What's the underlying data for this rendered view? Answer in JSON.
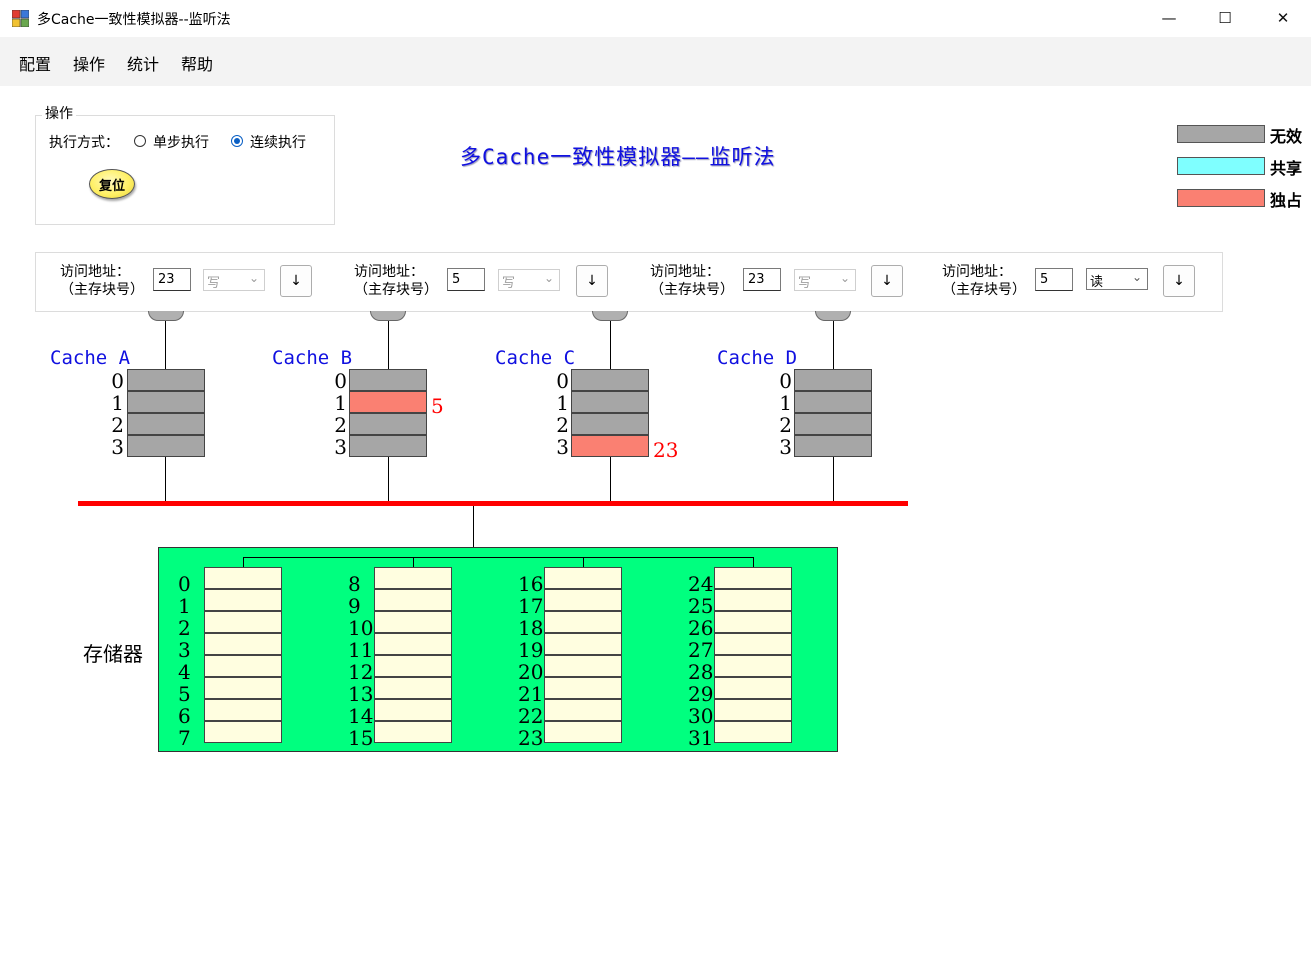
{
  "window": {
    "title": "多Cache一致性模拟器--监听法",
    "minimize": "—",
    "maximize": "☐",
    "close": "✕"
  },
  "menu": [
    "配置",
    "操作",
    "统计",
    "帮助"
  ],
  "operation": {
    "legend": "操作",
    "mode_label": "执行方式：",
    "modes": [
      {
        "label": "单步执行",
        "selected": false
      },
      {
        "label": "连续执行",
        "selected": true
      }
    ],
    "reset_label": "复位"
  },
  "main_title": "多Cache一致性模拟器——监听法",
  "legend": [
    {
      "label": "无效",
      "color": "#a6a6a6"
    },
    {
      "label": "共享",
      "color": "#7fffff"
    },
    {
      "label": "独占",
      "color": "#fa8072"
    }
  ],
  "access_label": [
    "访问地址：",
    "（主存块号）"
  ],
  "processors": [
    {
      "address": "23",
      "op": "写",
      "enabled": false,
      "step": "↓"
    },
    {
      "address": "5",
      "op": "写",
      "enabled": false,
      "step": "↓"
    },
    {
      "address": "23",
      "op": "写",
      "enabled": false,
      "step": "↓"
    },
    {
      "address": "5",
      "op": "读",
      "enabled": true,
      "step": "↓"
    }
  ],
  "caches": [
    {
      "name": "Cache  A",
      "lines": [
        {
          "index": "0",
          "state": "invalid",
          "value": ""
        },
        {
          "index": "1",
          "state": "invalid",
          "value": ""
        },
        {
          "index": "2",
          "state": "invalid",
          "value": ""
        },
        {
          "index": "3",
          "state": "invalid",
          "value": ""
        }
      ]
    },
    {
      "name": "Cache  B",
      "lines": [
        {
          "index": "0",
          "state": "invalid",
          "value": ""
        },
        {
          "index": "1",
          "state": "exclusive",
          "value": "5"
        },
        {
          "index": "2",
          "state": "invalid",
          "value": ""
        },
        {
          "index": "3",
          "state": "invalid",
          "value": ""
        }
      ]
    },
    {
      "name": "Cache  C",
      "lines": [
        {
          "index": "0",
          "state": "invalid",
          "value": ""
        },
        {
          "index": "1",
          "state": "invalid",
          "value": ""
        },
        {
          "index": "2",
          "state": "invalid",
          "value": ""
        },
        {
          "index": "3",
          "state": "exclusive",
          "value": "23"
        }
      ]
    },
    {
      "name": "Cache  D",
      "lines": [
        {
          "index": "0",
          "state": "invalid",
          "value": ""
        },
        {
          "index": "1",
          "state": "invalid",
          "value": ""
        },
        {
          "index": "2",
          "state": "invalid",
          "value": ""
        },
        {
          "index": "3",
          "state": "invalid",
          "value": ""
        }
      ]
    }
  ],
  "memory": {
    "label": "存储器",
    "columns": [
      [
        "0",
        "1",
        "2",
        "3",
        "4",
        "5",
        "6",
        "7"
      ],
      [
        "8",
        "9",
        "10",
        "11",
        "12",
        "13",
        "14",
        "15"
      ],
      [
        "16",
        "17",
        "18",
        "19",
        "20",
        "21",
        "22",
        "23"
      ],
      [
        "24",
        "25",
        "26",
        "27",
        "28",
        "29",
        "30",
        "31"
      ]
    ]
  }
}
